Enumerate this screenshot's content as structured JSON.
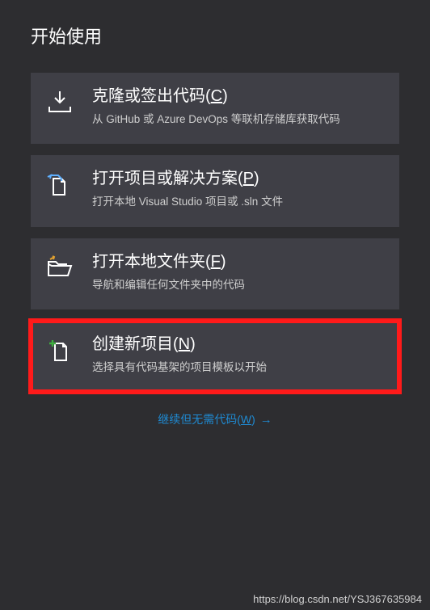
{
  "title": "开始使用",
  "cards": [
    {
      "title_prefix": "克隆或签出代码(",
      "hotkey": "C",
      "title_suffix": ")",
      "desc": "从 GitHub 或 Azure DevOps 等联机存储库获取代码"
    },
    {
      "title_prefix": "打开项目或解决方案(",
      "hotkey": "P",
      "title_suffix": ")",
      "desc": "打开本地 Visual Studio 项目或 .sln 文件"
    },
    {
      "title_prefix": "打开本地文件夹(",
      "hotkey": "F",
      "title_suffix": ")",
      "desc": "导航和编辑任何文件夹中的代码"
    },
    {
      "title_prefix": "创建新项目(",
      "hotkey": "N",
      "title_suffix": ")",
      "desc": "选择具有代码基架的项目模板以开始"
    }
  ],
  "link": {
    "prefix": "继续但无需代码(",
    "hotkey": "W",
    "suffix": ")",
    "arrow": "→"
  },
  "watermark": "https://blog.csdn.net/YSJ367635984"
}
